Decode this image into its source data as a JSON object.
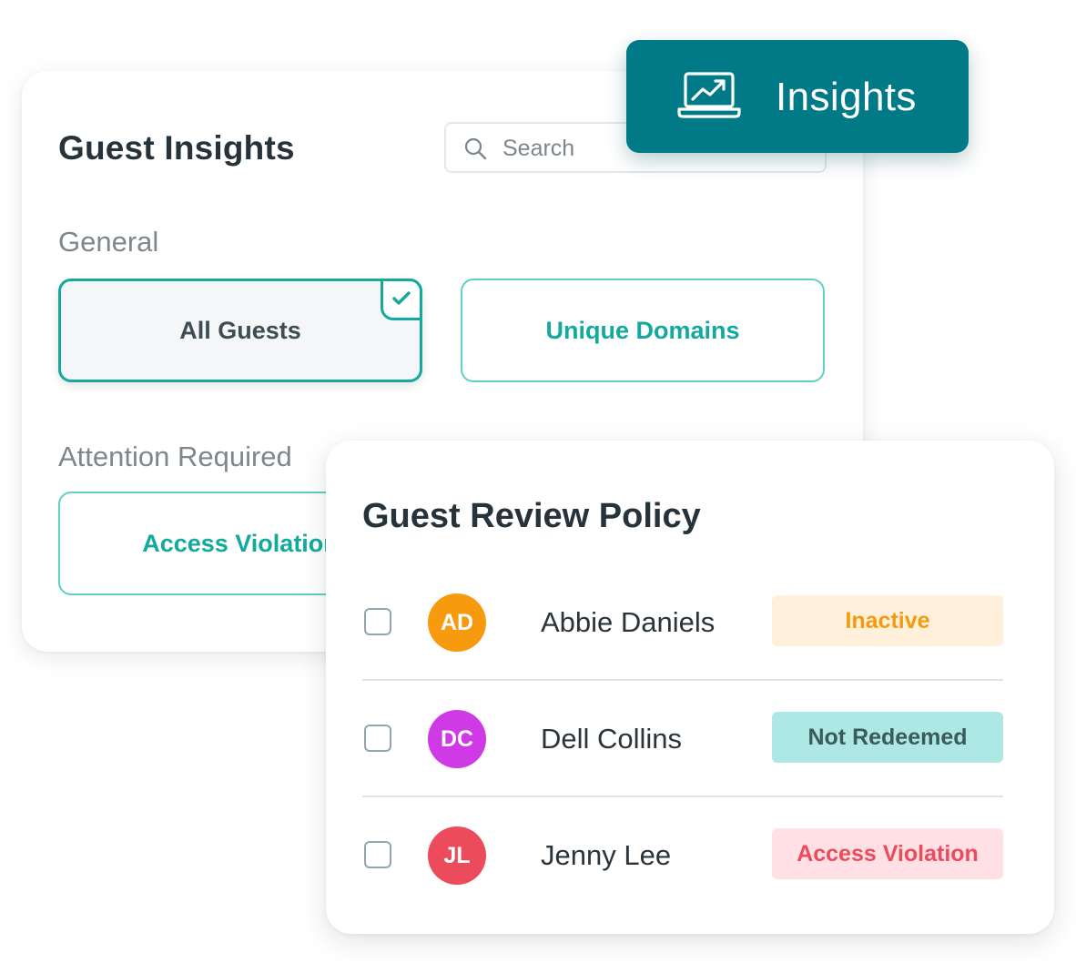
{
  "insights_panel": {
    "title": "Guest Insights",
    "search": {
      "placeholder": "Search"
    },
    "general": {
      "label": "General",
      "options": [
        {
          "label": "All Guests",
          "selected": true
        },
        {
          "label": "Unique Domains",
          "selected": false
        }
      ]
    },
    "attention": {
      "label": "Attention Required",
      "options": [
        {
          "label": "Access Violation",
          "selected": false
        }
      ]
    }
  },
  "badge": {
    "label": "Insights",
    "icon": "laptop-trend-icon"
  },
  "policy_panel": {
    "title": "Guest Review Policy",
    "rows": [
      {
        "initials": "AD",
        "name": "Abbie Daniels",
        "status": "Inactive",
        "avatar_color": "#f79a0e",
        "status_bg": "#fff0dc",
        "status_fg": "#f39b0f"
      },
      {
        "initials": "DC",
        "name": "Dell Collins",
        "status": "Not Redeemed",
        "avatar_color": "#d03ae6",
        "status_bg": "#aee8e4",
        "status_fg": "#3a5a5d"
      },
      {
        "initials": "JL",
        "name": "Jenny Lee",
        "status": "Access Violation",
        "avatar_color": "#ec4b5c",
        "status_bg": "#ffe0e4",
        "status_fg": "#ec4b5c"
      }
    ]
  },
  "colors": {
    "brand_teal": "#017a87",
    "accent_teal": "#15a89c",
    "text_dark": "#27333a"
  }
}
